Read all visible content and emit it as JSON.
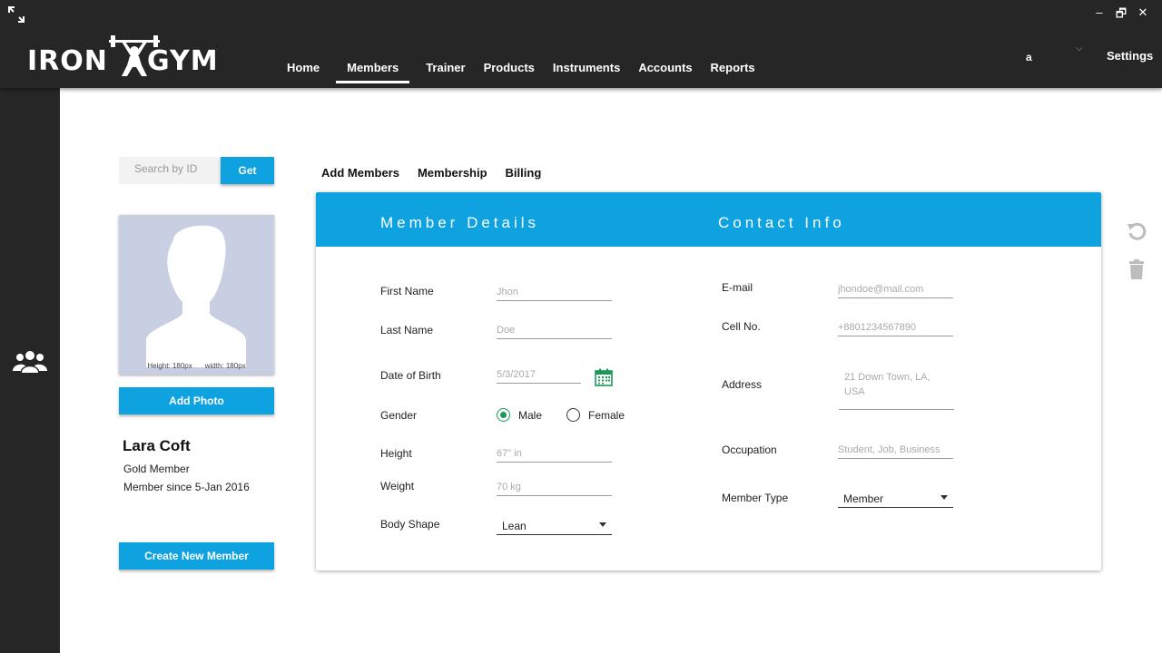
{
  "app": {
    "logo_left": "IRON",
    "logo_right": "GYM"
  },
  "window": {
    "minimize": "–",
    "restore": "🗗",
    "close": "✕"
  },
  "nav": {
    "items": [
      {
        "label": "Home"
      },
      {
        "label": "Members",
        "active": true
      },
      {
        "label": "Trainer"
      },
      {
        "label": "Products"
      },
      {
        "label": "Instruments"
      },
      {
        "label": "Accounts"
      },
      {
        "label": "Reports"
      }
    ]
  },
  "user": {
    "name": "a",
    "settings_label": "Settings"
  },
  "search": {
    "placeholder": "Search by ID",
    "button_label": "Get"
  },
  "photo": {
    "hint_height": "Height: 180px",
    "hint_width": "width: 180px",
    "add_button": "Add Photo"
  },
  "profile": {
    "name": "Lara Coft",
    "level": "Gold Member",
    "since": "Member since 5-Jan 2016",
    "create_button": "Create New Member"
  },
  "subtabs": [
    "Add Members",
    "Membership",
    "Billing"
  ],
  "form": {
    "section_member": "Member Details",
    "section_contact": "Contact Info",
    "first_name": {
      "label": "First Name",
      "value": "Jhon"
    },
    "last_name": {
      "label": "Last Name",
      "value": "Doe"
    },
    "dob": {
      "label": "Date of Birth",
      "value": "5/3/2017"
    },
    "gender": {
      "label": "Gender",
      "options": [
        "Male",
        "Female"
      ],
      "selected": "Male"
    },
    "height": {
      "label": "Height",
      "value": "67\" in"
    },
    "weight": {
      "label": "Weight",
      "value": "70 kg"
    },
    "body_shape": {
      "label": "Body Shape",
      "value": "Lean"
    },
    "email": {
      "label": "E-mail",
      "value": "jhondoe@mail.com"
    },
    "cell": {
      "label": "Cell No.",
      "value": "+8801234567890"
    },
    "address": {
      "label": "Address",
      "line1": "21 Down Town, LA,",
      "line2": "USA"
    },
    "occupation": {
      "label": "Occupation",
      "value": "Student, Job, Business"
    },
    "member_type": {
      "label": "Member Type",
      "value": "Member"
    }
  },
  "colors": {
    "accent": "#0ea3e0",
    "topbar": "#262626",
    "radio_on": "#1a9a55"
  },
  "icons": [
    "expand-icon",
    "group-icon",
    "calendar-icon",
    "refresh-icon",
    "trash-icon"
  ]
}
